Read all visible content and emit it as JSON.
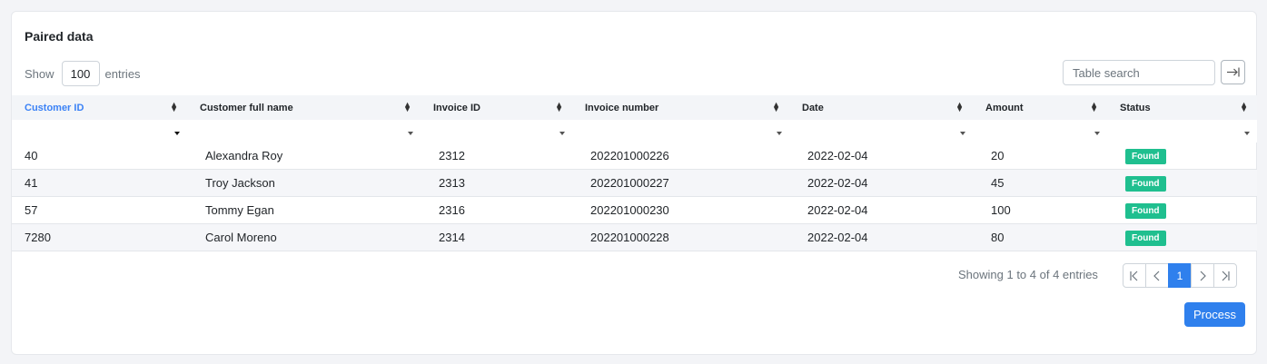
{
  "card": {
    "title": "Paired data"
  },
  "length": {
    "show_label": "Show",
    "value": "100",
    "entries_label": "entries"
  },
  "search": {
    "placeholder": "Table search"
  },
  "table": {
    "columns": [
      "Customer ID",
      "Customer full name",
      "Invoice ID",
      "Invoice number",
      "Date",
      "Amount",
      "Status"
    ],
    "rows": [
      {
        "customer_id": "40",
        "name": "Alexandra Roy",
        "invoice_id": "2312",
        "invoice_number": "202201000226",
        "date": "2022-02-04",
        "amount": "20",
        "status": "Found"
      },
      {
        "customer_id": "41",
        "name": "Troy Jackson",
        "invoice_id": "2313",
        "invoice_number": "202201000227",
        "date": "2022-02-04",
        "amount": "45",
        "status": "Found"
      },
      {
        "customer_id": "57",
        "name": "Tommy Egan",
        "invoice_id": "2316",
        "invoice_number": "202201000230",
        "date": "2022-02-04",
        "amount": "100",
        "status": "Found"
      },
      {
        "customer_id": "7280",
        "name": "Carol Moreno",
        "invoice_id": "2314",
        "invoice_number": "202201000228",
        "date": "2022-02-04",
        "amount": "80",
        "status": "Found"
      }
    ]
  },
  "footer": {
    "info": "Showing 1 to 4 of 4 entries",
    "current_page": "1",
    "process_label": "Process"
  },
  "colors": {
    "accent": "#2f80ed",
    "found": "#1fbf8f",
    "active_header": "#3b82f6"
  }
}
